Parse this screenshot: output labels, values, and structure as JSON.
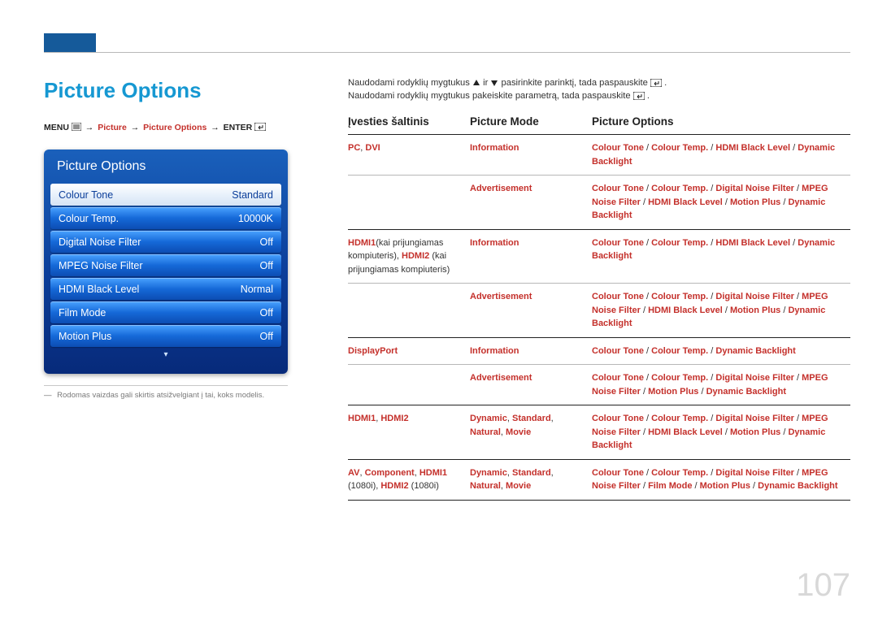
{
  "pageNumber": "107",
  "header": {
    "title": "Picture Options"
  },
  "breadcrumb": {
    "menu": "MENU",
    "p1": "Picture",
    "p2": "Picture Options",
    "enter": "ENTER"
  },
  "osd": {
    "title": "Picture Options",
    "items": [
      {
        "label": "Colour Tone",
        "value": "Standard",
        "selected": true
      },
      {
        "label": "Colour Temp.",
        "value": "10000K",
        "selected": false
      },
      {
        "label": "Digital Noise Filter",
        "value": "Off",
        "selected": false
      },
      {
        "label": "MPEG Noise Filter",
        "value": "Off",
        "selected": false
      },
      {
        "label": "HDMI Black Level",
        "value": "Normal",
        "selected": false
      },
      {
        "label": "Film Mode",
        "value": "Off",
        "selected": false
      },
      {
        "label": "Motion Plus",
        "value": "Off",
        "selected": false
      }
    ]
  },
  "footnote": "Rodomas vaizdas gali skirtis atsižvelgiant į tai, koks modelis.",
  "intro": {
    "line1_a": "Naudodami rodyklių mygtukus ",
    "line1_b": " ir ",
    "line1_c": " pasirinkite parinktį, tada paspauskite ",
    "line1_d": ".",
    "line2_a": "Naudodami rodyklių mygtukus pakeiskite parametrą, tada paspauskite ",
    "line2_b": "."
  },
  "table": {
    "headers": {
      "c1": "Įvesties šaltinis",
      "c2": "Picture Mode",
      "c3": "Picture Options"
    },
    "rows": [
      {
        "source": [
          {
            "t": "PC",
            "hl": true
          },
          {
            "t": ", ",
            "hl": false
          },
          {
            "t": "DVI",
            "hl": true
          }
        ],
        "mode": [
          {
            "t": "Information",
            "hl": true
          }
        ],
        "opts": [
          {
            "t": "Colour Tone",
            "hl": true
          },
          {
            "t": " / ",
            "hl": false
          },
          {
            "t": "Colour Temp.",
            "hl": true
          },
          {
            "t": " / ",
            "hl": false
          },
          {
            "t": "HDMI Black Level",
            "hl": true
          },
          {
            "t": " / ",
            "hl": false
          },
          {
            "t": "Dynamic Backlight",
            "hl": true
          }
        ],
        "groupEnd": false
      },
      {
        "source": [],
        "mode": [
          {
            "t": "Advertisement",
            "hl": true
          }
        ],
        "opts": [
          {
            "t": "Colour Tone",
            "hl": true
          },
          {
            "t": " / ",
            "hl": false
          },
          {
            "t": "Colour Temp.",
            "hl": true
          },
          {
            "t": " / ",
            "hl": false
          },
          {
            "t": "Digital Noise Filter",
            "hl": true
          },
          {
            "t": " / ",
            "hl": false
          },
          {
            "t": "MPEG Noise Filter",
            "hl": true
          },
          {
            "t": " / ",
            "hl": false
          },
          {
            "t": "HDMI Black Level",
            "hl": true
          },
          {
            "t": " / ",
            "hl": false
          },
          {
            "t": "Motion Plus",
            "hl": true
          },
          {
            "t": " / ",
            "hl": false
          },
          {
            "t": "Dynamic Backlight",
            "hl": true
          }
        ],
        "groupEnd": true
      },
      {
        "source": [
          {
            "t": "HDMI1",
            "hl": true
          },
          {
            "t": "(kai prijungiamas kompiuteris), ",
            "hl": false
          },
          {
            "t": "HDMI2",
            "hl": true
          },
          {
            "t": " (kai prijungiamas kompiuteris)",
            "hl": false
          }
        ],
        "mode": [
          {
            "t": "Information",
            "hl": true
          }
        ],
        "opts": [
          {
            "t": "Colour Tone",
            "hl": true
          },
          {
            "t": " / ",
            "hl": false
          },
          {
            "t": "Colour Temp.",
            "hl": true
          },
          {
            "t": " / ",
            "hl": false
          },
          {
            "t": "HDMI Black Level",
            "hl": true
          },
          {
            "t": " / ",
            "hl": false
          },
          {
            "t": "Dynamic Backlight",
            "hl": true
          }
        ],
        "groupEnd": false
      },
      {
        "source": [],
        "mode": [
          {
            "t": "Advertisement",
            "hl": true
          }
        ],
        "opts": [
          {
            "t": "Colour Tone",
            "hl": true
          },
          {
            "t": " / ",
            "hl": false
          },
          {
            "t": "Colour Temp.",
            "hl": true
          },
          {
            "t": " / ",
            "hl": false
          },
          {
            "t": "Digital Noise Filter",
            "hl": true
          },
          {
            "t": " / ",
            "hl": false
          },
          {
            "t": "MPEG Noise Filter",
            "hl": true
          },
          {
            "t": " / ",
            "hl": false
          },
          {
            "t": "HDMI Black Level",
            "hl": true
          },
          {
            "t": " / ",
            "hl": false
          },
          {
            "t": "Motion Plus",
            "hl": true
          },
          {
            "t": " / ",
            "hl": false
          },
          {
            "t": "Dynamic Backlight",
            "hl": true
          }
        ],
        "groupEnd": true
      },
      {
        "source": [
          {
            "t": "DisplayPort",
            "hl": true
          }
        ],
        "mode": [
          {
            "t": "Information",
            "hl": true
          }
        ],
        "opts": [
          {
            "t": "Colour Tone",
            "hl": true
          },
          {
            "t": " / ",
            "hl": false
          },
          {
            "t": "Colour Temp.",
            "hl": true
          },
          {
            "t": " / ",
            "hl": false
          },
          {
            "t": "Dynamic Backlight",
            "hl": true
          }
        ],
        "groupEnd": false
      },
      {
        "source": [],
        "mode": [
          {
            "t": "Advertisement",
            "hl": true
          }
        ],
        "opts": [
          {
            "t": "Colour Tone",
            "hl": true
          },
          {
            "t": " / ",
            "hl": false
          },
          {
            "t": "Colour Temp.",
            "hl": true
          },
          {
            "t": " / ",
            "hl": false
          },
          {
            "t": "Digital Noise Filter",
            "hl": true
          },
          {
            "t": " / ",
            "hl": false
          },
          {
            "t": "MPEG Noise Filter",
            "hl": true
          },
          {
            "t": " / ",
            "hl": false
          },
          {
            "t": "Motion Plus",
            "hl": true
          },
          {
            "t": " / ",
            "hl": false
          },
          {
            "t": "Dynamic Backlight",
            "hl": true
          }
        ],
        "groupEnd": true
      },
      {
        "source": [
          {
            "t": "HDMI1",
            "hl": true
          },
          {
            "t": ", ",
            "hl": false
          },
          {
            "t": "HDMI2",
            "hl": true
          }
        ],
        "mode": [
          {
            "t": "Dynamic",
            "hl": true
          },
          {
            "t": ", ",
            "hl": false
          },
          {
            "t": "Standard",
            "hl": true
          },
          {
            "t": ", ",
            "hl": false
          },
          {
            "t": "Natural",
            "hl": true
          },
          {
            "t": ", ",
            "hl": false
          },
          {
            "t": "Movie",
            "hl": true
          }
        ],
        "opts": [
          {
            "t": "Colour Tone",
            "hl": true
          },
          {
            "t": " / ",
            "hl": false
          },
          {
            "t": "Colour Temp.",
            "hl": true
          },
          {
            "t": " / ",
            "hl": false
          },
          {
            "t": "Digital Noise Filter",
            "hl": true
          },
          {
            "t": " / ",
            "hl": false
          },
          {
            "t": "MPEG Noise Filter",
            "hl": true
          },
          {
            "t": " / ",
            "hl": false
          },
          {
            "t": "HDMI Black Level",
            "hl": true
          },
          {
            "t": " / ",
            "hl": false
          },
          {
            "t": "Motion Plus",
            "hl": true
          },
          {
            "t": " / ",
            "hl": false
          },
          {
            "t": "Dynamic Backlight",
            "hl": true
          }
        ],
        "groupEnd": true
      },
      {
        "source": [
          {
            "t": "AV",
            "hl": true
          },
          {
            "t": ", ",
            "hl": false
          },
          {
            "t": "Component",
            "hl": true
          },
          {
            "t": ", ",
            "hl": false
          },
          {
            "t": "HDMI1",
            "hl": true
          },
          {
            "t": " (1080i), ",
            "hl": false
          },
          {
            "t": "HDMI2",
            "hl": true
          },
          {
            "t": " (1080i)",
            "hl": false
          }
        ],
        "mode": [
          {
            "t": "Dynamic",
            "hl": true
          },
          {
            "t": ", ",
            "hl": false
          },
          {
            "t": "Standard",
            "hl": true
          },
          {
            "t": ", ",
            "hl": false
          },
          {
            "t": "Natural",
            "hl": true
          },
          {
            "t": ", ",
            "hl": false
          },
          {
            "t": "Movie",
            "hl": true
          }
        ],
        "opts": [
          {
            "t": "Colour Tone",
            "hl": true
          },
          {
            "t": " / ",
            "hl": false
          },
          {
            "t": "Colour Temp.",
            "hl": true
          },
          {
            "t": " / ",
            "hl": false
          },
          {
            "t": "Digital Noise Filter",
            "hl": true
          },
          {
            "t": " / ",
            "hl": false
          },
          {
            "t": "MPEG Noise Filter",
            "hl": true
          },
          {
            "t": " / ",
            "hl": false
          },
          {
            "t": "Film Mode",
            "hl": true
          },
          {
            "t": " / ",
            "hl": false
          },
          {
            "t": "Motion Plus",
            "hl": true
          },
          {
            "t": " / ",
            "hl": false
          },
          {
            "t": "Dynamic Backlight",
            "hl": true
          }
        ],
        "groupEnd": true
      }
    ]
  }
}
